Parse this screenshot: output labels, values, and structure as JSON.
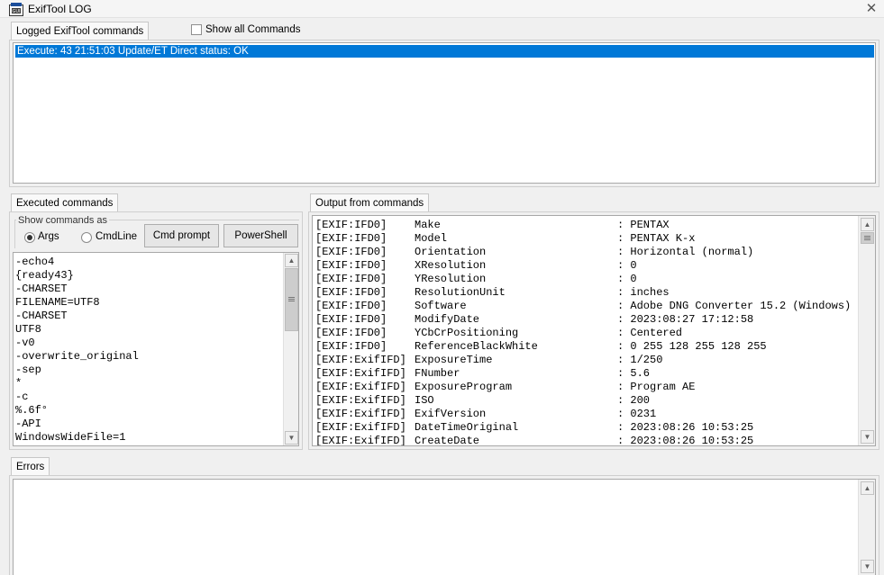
{
  "window": {
    "title": "ExifTool LOG",
    "close_glyph": "✕"
  },
  "logged": {
    "tab_label": "Logged ExifTool commands",
    "show_all_label": "Show all Commands",
    "show_all_checked": false,
    "rows": [
      "Execute: 43 21:51:03 Update/ET Direct status: OK"
    ]
  },
  "executed": {
    "tab_label": "Executed commands",
    "group_label": "Show commands as",
    "radio_args": "Args",
    "radio_cmdline": "CmdLine",
    "selected": "Args",
    "btn_cmd": "Cmd prompt",
    "btn_ps": "PowerShell",
    "lines": [
      "-echo4",
      "{ready43}",
      "-CHARSET",
      "FILENAME=UTF8",
      "-CHARSET",
      "UTF8",
      "-v0",
      "-overwrite_original",
      "-sep",
      "*",
      "-c",
      "%.6f°",
      "-API",
      "WindowsWideFile=1"
    ]
  },
  "output": {
    "tab_label": "Output from commands",
    "rows": [
      {
        "group": "[EXIF:IFD0]",
        "tag": "Make",
        "value": ": PENTAX"
      },
      {
        "group": "[EXIF:IFD0]",
        "tag": "Model",
        "value": ": PENTAX K-x"
      },
      {
        "group": "[EXIF:IFD0]",
        "tag": "Orientation",
        "value": ": Horizontal (normal)"
      },
      {
        "group": "[EXIF:IFD0]",
        "tag": "XResolution",
        "value": ": 0"
      },
      {
        "group": "[EXIF:IFD0]",
        "tag": "YResolution",
        "value": ": 0"
      },
      {
        "group": "[EXIF:IFD0]",
        "tag": "ResolutionUnit",
        "value": ": inches"
      },
      {
        "group": "[EXIF:IFD0]",
        "tag": "Software",
        "value": ": Adobe DNG Converter 15.2 (Windows)"
      },
      {
        "group": "[EXIF:IFD0]",
        "tag": "ModifyDate",
        "value": ": 2023:08:27 17:12:58"
      },
      {
        "group": "[EXIF:IFD0]",
        "tag": "YCbCrPositioning",
        "value": ": Centered"
      },
      {
        "group": "[EXIF:IFD0]",
        "tag": "ReferenceBlackWhite",
        "value": ": 0 255 128 255 128 255"
      },
      {
        "group": "[EXIF:ExifIFD]",
        "tag": "ExposureTime",
        "value": ": 1/250"
      },
      {
        "group": "[EXIF:ExifIFD]",
        "tag": "FNumber",
        "value": ": 5.6"
      },
      {
        "group": "[EXIF:ExifIFD]",
        "tag": "ExposureProgram",
        "value": ": Program AE"
      },
      {
        "group": "[EXIF:ExifIFD]",
        "tag": "ISO",
        "value": ": 200"
      },
      {
        "group": "[EXIF:ExifIFD]",
        "tag": "ExifVersion",
        "value": ": 0231"
      },
      {
        "group": "[EXIF:ExifIFD]",
        "tag": "DateTimeOriginal",
        "value": ": 2023:08:26 10:53:25"
      },
      {
        "group": "[EXIF:ExifIFD]",
        "tag": "CreateDate",
        "value": ": 2023:08:26 10:53:25"
      }
    ]
  },
  "errors": {
    "tab_label": "Errors"
  },
  "colors": {
    "selection": "#0078d7",
    "background": "#f0f0f0"
  }
}
